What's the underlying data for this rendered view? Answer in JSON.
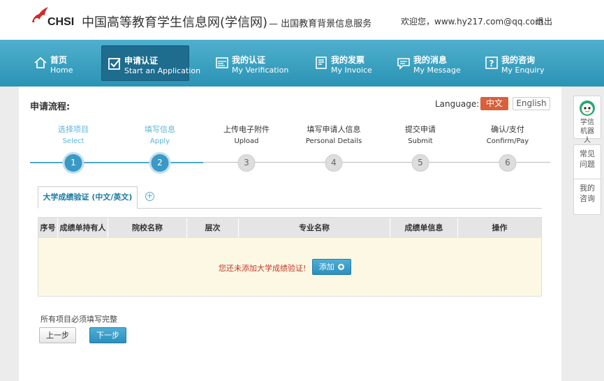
{
  "header": {
    "logo_text": "CHSI",
    "site_title": "中国高等教育学生信息网(学信网)",
    "site_subtitle": "— 出国教育背景信息服务",
    "welcome": "欢迎您，www.hy217.com@qq.com",
    "logout": "退出"
  },
  "nav": [
    {
      "zh": "首页",
      "en": "Home",
      "icon": "home-icon"
    },
    {
      "zh": "申请认证",
      "en": "Start an Application",
      "icon": "checkbox-icon"
    },
    {
      "zh": "我的认证",
      "en": "My Verification",
      "icon": "verification-icon"
    },
    {
      "zh": "我的发票",
      "en": "My Invoice",
      "icon": "invoice-icon"
    },
    {
      "zh": "我的消息",
      "en": "My Message",
      "icon": "message-icon"
    },
    {
      "zh": "我的咨询",
      "en": "My Enquiry",
      "icon": "enquiry-icon"
    }
  ],
  "main": {
    "process_title": "申请流程:",
    "language_label": "Language:",
    "lang_zh": "中文",
    "lang_en": "English",
    "steps": [
      {
        "zh": "选择项目",
        "en": "Select",
        "num": "1"
      },
      {
        "zh": "填写信息",
        "en": "Apply",
        "num": "2"
      },
      {
        "zh": "上传电子附件",
        "en": "Upload",
        "num": "3"
      },
      {
        "zh": "填写申请人信息",
        "en": "Personal Details",
        "num": "4"
      },
      {
        "zh": "提交申请",
        "en": "Submit",
        "num": "5"
      },
      {
        "zh": "确认/支付",
        "en": "Confirm/Pay",
        "num": "6"
      }
    ],
    "tab_label": "大学成绩验证 (中文/英文)",
    "tab_add": "+",
    "table": {
      "headers": [
        "序号",
        "成绩单持有人",
        "院校名称",
        "层次",
        "专业名称",
        "成绩单信息",
        "操作"
      ],
      "empty_message": "您还未添加大学成绩验证!",
      "add_button": "添加"
    },
    "note": "所有项目必须填写完整",
    "prev_button": "上一步",
    "next_button": "下一步"
  },
  "side": {
    "robot": "学信机器人",
    "faq": "常见问题",
    "ask": "我的咨询"
  },
  "colors": {
    "nav_bg": "#2b93b5",
    "accent": "#3a99c7",
    "lang_active": "#d9603b",
    "empty_bg": "#fcf8e3",
    "empty_text": "#c0392b"
  }
}
